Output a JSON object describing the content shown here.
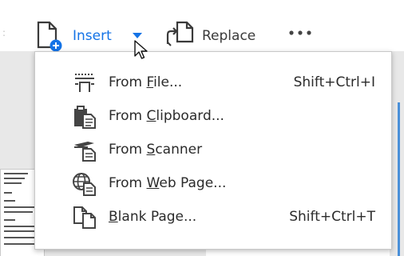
{
  "toolbar": {
    "insert_label": "Insert",
    "replace_label": "Replace",
    "more_label": "•••",
    "separator": ":",
    "accent_color": "#1473e6"
  },
  "menu": {
    "items": [
      {
        "prefix": "From ",
        "accel": "F",
        "suffix": "ile...",
        "shortcut": "Shift+Ctrl+I",
        "icon": "from-file-icon"
      },
      {
        "prefix": "From ",
        "accel": "C",
        "suffix": "lipboard...",
        "shortcut": "",
        "icon": "clipboard-icon"
      },
      {
        "prefix": "From ",
        "accel": "S",
        "suffix": "canner",
        "shortcut": "",
        "icon": "scanner-icon"
      },
      {
        "prefix": "From ",
        "accel": "W",
        "suffix": "eb Page...",
        "shortcut": "",
        "icon": "web-page-icon"
      },
      {
        "prefix": "",
        "accel": "B",
        "suffix": "lank Page...",
        "shortcut": "Shift+Ctrl+T",
        "icon": "blank-page-icon"
      }
    ]
  },
  "background": {
    "thumbnail_lines": 12
  }
}
